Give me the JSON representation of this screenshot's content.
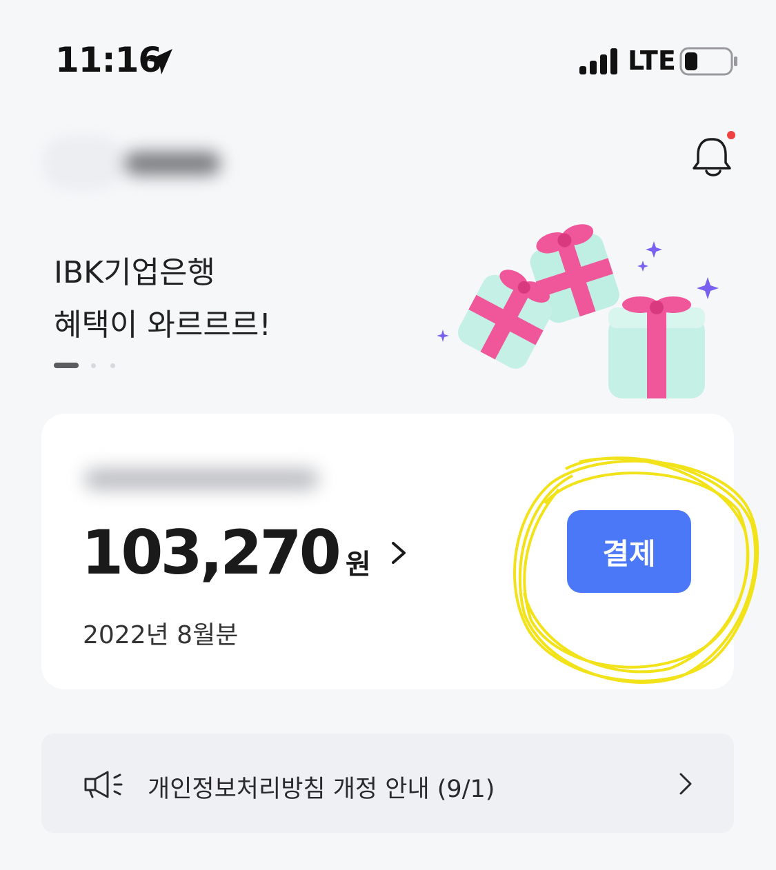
{
  "status_bar": {
    "time": "11:16",
    "network": "LTE",
    "icons": [
      "location-arrow-icon",
      "cellular-signal-icon",
      "battery-icon"
    ]
  },
  "header": {
    "notification_icon": "bell-icon",
    "has_unread_notification": true
  },
  "banner": {
    "title": "IBK기업은행\n혜택이 와르르르!",
    "page_indicator": {
      "total": 3,
      "current": 1
    },
    "illustration": "gift-boxes"
  },
  "bill_card": {
    "amount": "103,270",
    "currency": "원",
    "period": "2022년 8월분",
    "pay_button_label": "결제"
  },
  "notice": {
    "icon": "megaphone-icon",
    "text": "개인정보처리방침 개정 안내 (9/1)"
  },
  "colors": {
    "background": "#f6f7f9",
    "accent": "#4a78f7",
    "notification_dot": "#f04040",
    "highlight": "#f2e21a",
    "gift_pink": "#f0569a",
    "gift_mint": "#bfeee3"
  }
}
